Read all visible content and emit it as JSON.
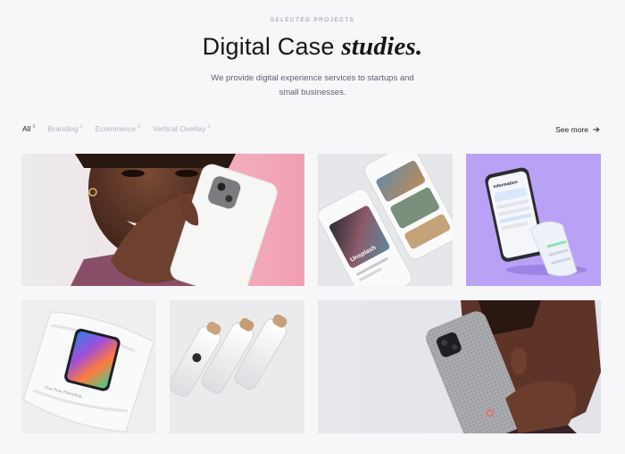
{
  "header": {
    "eyebrow": "SELECTED PROJECTS",
    "title_plain": "Digital Case",
    "title_italic": "studies.",
    "subtitle": "We provide digital experience services to startups and small businesses."
  },
  "filters": [
    {
      "label": "All",
      "count": "6",
      "active": true
    },
    {
      "label": "Branding",
      "count": "1",
      "active": false
    },
    {
      "label": "Ecommerce",
      "count": "2",
      "active": false
    },
    {
      "label": "Vertical Overlay",
      "count": "1",
      "active": false
    }
  ],
  "see_more": {
    "label": "See more",
    "icon": "arrow-right-icon"
  },
  "projects": {
    "card1": {
      "name": "woman-holding-pixel-phone"
    },
    "card2": {
      "name": "two-phones-unsplash-app",
      "screen_text": "Unsplash"
    },
    "card3": {
      "name": "phone-with-receipt-purple",
      "screen_text": "Information"
    },
    "card4": {
      "name": "phone-in-plastic-wrap",
      "wrap_text": "Fine Print Photoshop"
    },
    "card5": {
      "name": "white-bottles-wood-caps"
    },
    "card6": {
      "name": "man-on-phone-call"
    }
  },
  "colors": {
    "background": "#f7f7fa",
    "pink": "#f2a8b8",
    "purple": "#b9a2f5",
    "text": "#1d1d22",
    "muted": "#b4b6c2"
  }
}
